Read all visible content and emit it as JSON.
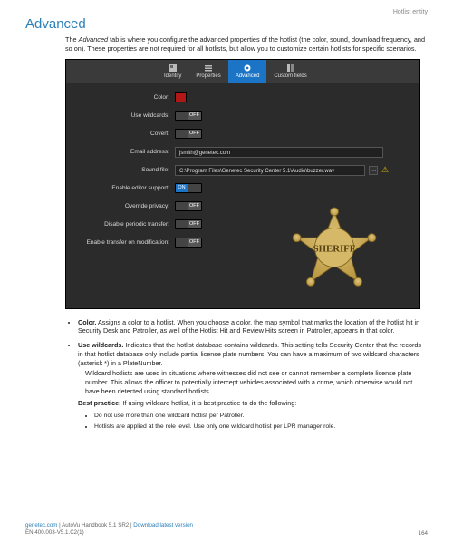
{
  "header": {
    "entity": "Hotlist entity"
  },
  "section": {
    "title": "Advanced"
  },
  "intro": {
    "pre": "The ",
    "em": "Advanced",
    "post": " tab is where you configure the advanced properties of the hotlist (the color, sound, download frequency, and so on). These properties are not required for all hotlists, but allow you to customize certain hotlists for specific scenarios."
  },
  "tabs": {
    "identity": "Identity",
    "properties": "Properties",
    "advanced": "Advanced",
    "custom": "Custom fields"
  },
  "form": {
    "color_label": "Color:",
    "use_wildcards_label": "Use wildcards:",
    "covert_label": "Covert:",
    "email_label": "Email address:",
    "email_value": "jsmith@genetec.com",
    "sound_label": "Sound file:",
    "sound_value": "C:\\Program Files\\Genetec Security Center 5.1\\Audio\\buzzer.wav",
    "editor_label": "Enable editor support:",
    "override_label": "Override privacy:",
    "disable_periodic_label": "Disable periodic transfer:",
    "enable_mod_label": "Enable transfer on modification:",
    "off": "OFF",
    "on": "ON"
  },
  "badge": {
    "text": "SHERIFF"
  },
  "body": {
    "color_term": "Color.",
    "color_text": "  Assigns a color to a hotlist. When you choose a color, the map symbol that marks the location of the hotlist hit in Security Desk and Patroller, as well of the Hotlist Hit and Review Hits screen in Patroller, appears in that color.",
    "wild_term": "Use wildcards.",
    "wild_text": "  Indicates that the hotlist database contains wildcards. This setting tells Security Center that the records in that hotlist database only include partial license plate numbers. You can have a maximum of two wildcard characters (asterisk *) in a PlateNumber.",
    "wild_para": "Wildcard hotlists are used in situations where witnesses did not see or cannot remember a complete license plate number. This allows the officer to potentially intercept vehicles associated with a crime, which otherwise would not have been detected using standard hotlists.",
    "bp_label": "Best practice:",
    "bp_text": " If using wildcard hotlist, it is best practice to do the following:",
    "bp1": "Do not use more than one wildcard hotlist per Patroller.",
    "bp2": "Hotlists are applied at the role level. Use only one wildcard hotlist per LPR manager role."
  },
  "footer": {
    "site": "genetec.com",
    "sep": " | ",
    "book": "AutoVu Handbook 5.1 SR2",
    "link": "Download latest version",
    "ref": "EN.400.003-V5.1.C2(1)",
    "page": "164"
  }
}
